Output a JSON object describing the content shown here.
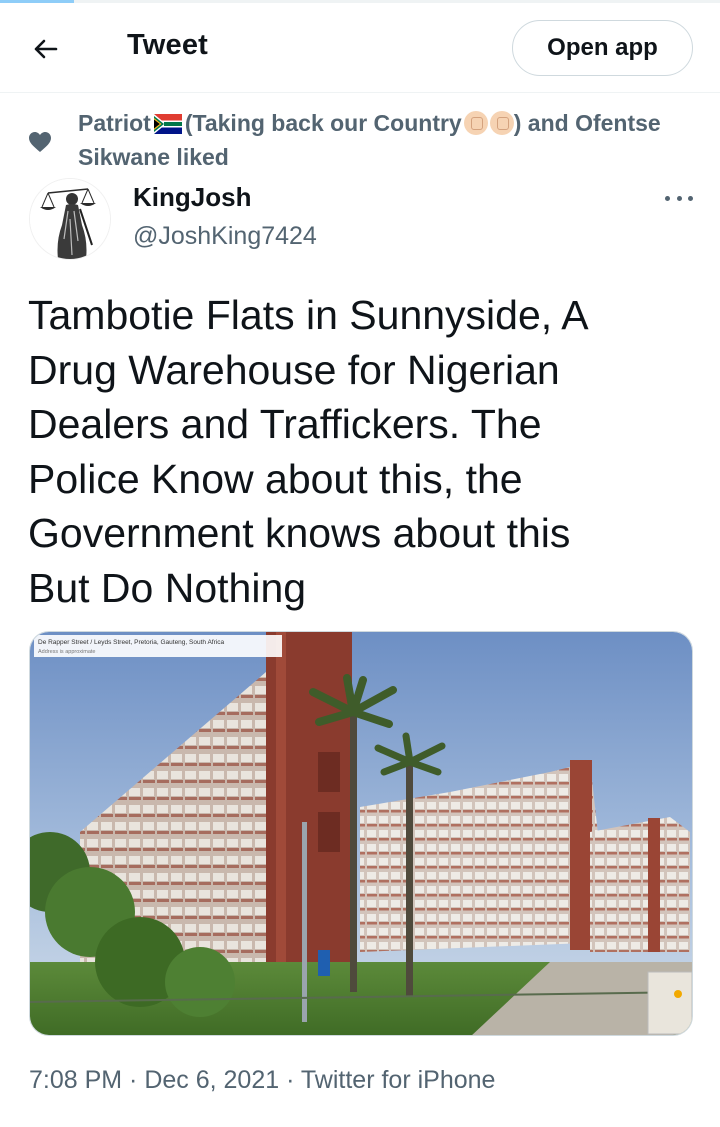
{
  "header": {
    "title": "Tweet",
    "open_app_label": "Open app"
  },
  "social_context": {
    "text_part1": "Patriot",
    "text_part2": "(Taking back our Country",
    "text_part3": ") and Ofentse Sikwane liked"
  },
  "tweet": {
    "display_name": "KingJosh",
    "handle": "@JoshKing7424",
    "text": "Tambotie Flats in Sunnyside, A\nDrug Warehouse for Nigerian\nDealers and Traffickers. The\nPolice Know about this, the\nGovernment knows about this\nBut Do Nothing",
    "media": {
      "caption_line1": "De Rapper Street / Leyds Street, Pretoria, Gauteng, South Africa",
      "caption_line2": "Address is approximate"
    },
    "timestamp": "7:08 PM · Dec 6, 2021 · Twitter for iPhone"
  },
  "icons": {
    "back": "arrow-left-icon",
    "liked": "heart-icon",
    "more": "more-horizontal-icon",
    "flag": "south-africa-flag-icon",
    "fist": "raised-fist-icon"
  },
  "colors": {
    "text_primary": "#0f1419",
    "text_secondary": "#536471",
    "border": "#cfd9de",
    "accent": "#8ecdf8"
  }
}
